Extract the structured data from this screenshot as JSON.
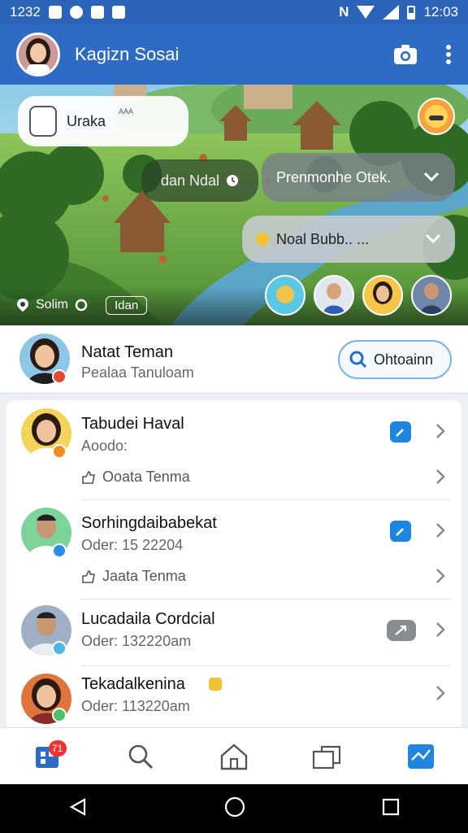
{
  "status_bar": {
    "time_left": "1232",
    "time_right": "12:03"
  },
  "app_bar": {
    "title": "Kagizn Sosai"
  },
  "hero": {
    "bubble_1_text": "Uraka",
    "bubble_1_small": "AAA",
    "bubble_2_text": "dan Ndal",
    "bubble_3_text": "Prenmonhe Otek.",
    "bubble_4_text": "Noal Bubb.. ...",
    "location_label": "Solim",
    "chip_label": "Idan"
  },
  "top_card": {
    "name": "Natat Teman",
    "subtitle": "Pealaa Tanuloam",
    "search_button_label": "Ohtoainn"
  },
  "list": [
    {
      "name": "Tabudei Haval",
      "detail": "Aoodo:",
      "sub_item": "Ooata Tenma"
    },
    {
      "name": "Sorhingdaibabekat",
      "detail": "Oder: 15 22204",
      "sub_item": "Jaata Tenma"
    },
    {
      "name": "Lucadaila Cordcial",
      "detail": "Oder: 132220am"
    },
    {
      "name": "Tekadalkenina",
      "detail": "Oder: 113220am"
    }
  ],
  "bottom_nav": {
    "badge_count": "71"
  },
  "colors": {
    "app_bar": "#2e6bc4",
    "accent_blue": "#1f86e0",
    "sheet_bg": "#eceff3"
  }
}
